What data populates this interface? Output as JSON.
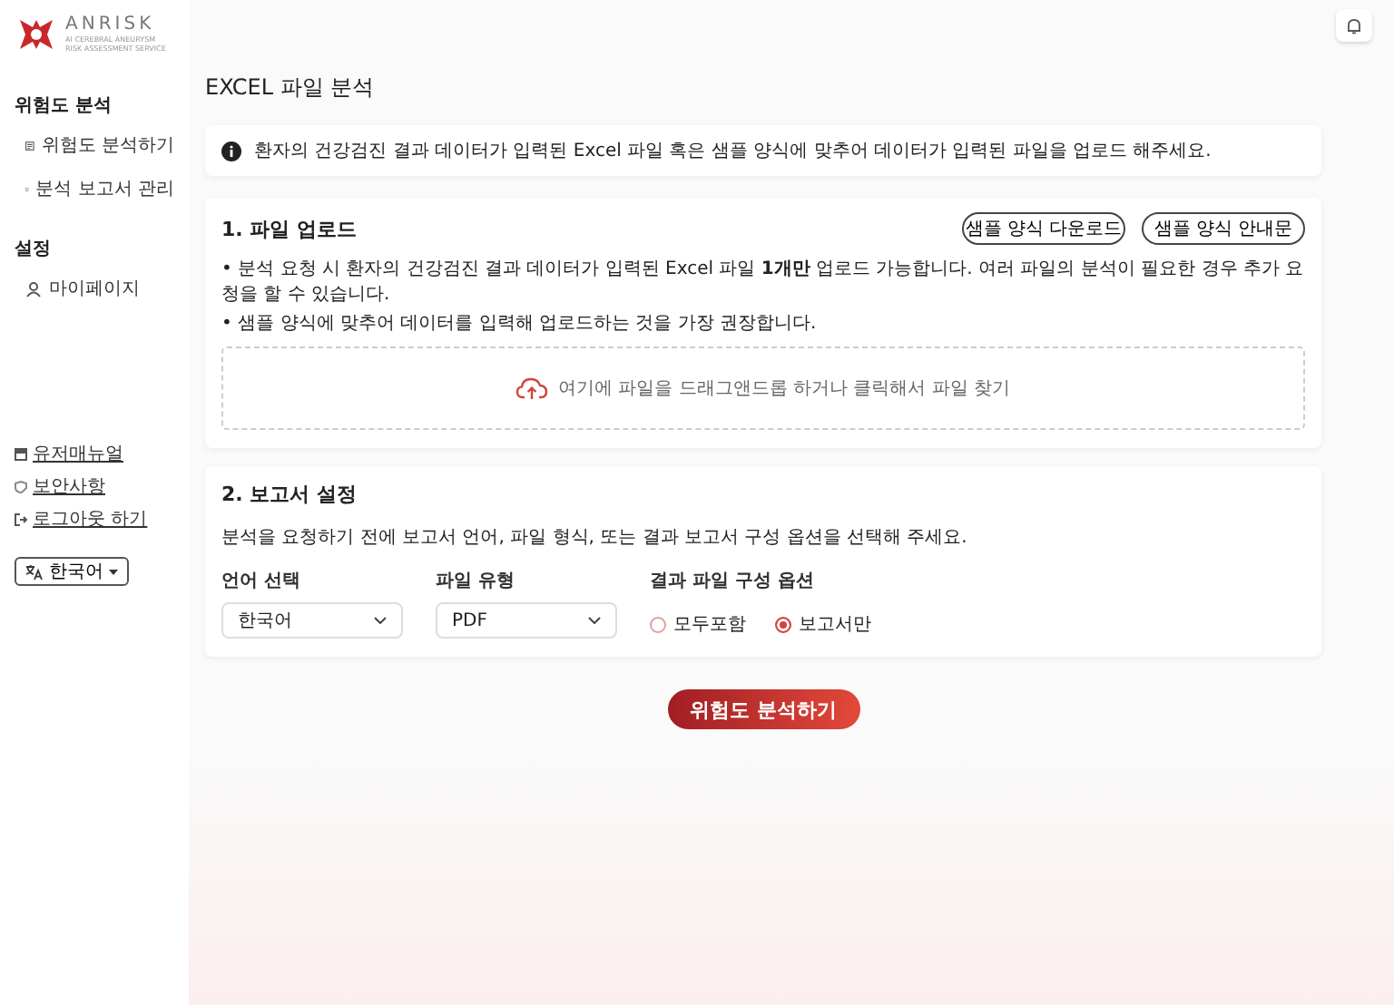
{
  "logo": {
    "name": "ANRISK",
    "tagline": [
      "AI CEREBRAL ANEURYSM",
      "RISK ASSESSMENT SERVICE"
    ]
  },
  "sidebar": {
    "sections": [
      {
        "title": "위험도 분석",
        "items": [
          {
            "label": "위험도 분석하기",
            "kind": "analyze"
          },
          {
            "label": "분석 보고서 관리",
            "kind": "report"
          }
        ]
      },
      {
        "title": "설정",
        "items": [
          {
            "label": "마이페이지",
            "kind": "user"
          }
        ]
      }
    ],
    "links": [
      {
        "label": "유저매뉴얼",
        "kind": "manual"
      },
      {
        "label": "보안사항",
        "kind": "security"
      },
      {
        "label": "로그아웃 하기",
        "kind": "logout"
      }
    ],
    "language": "한국어"
  },
  "page": {
    "title": "EXCEL 파일 분석",
    "notice": "환자의 건강검진 결과 데이터가 입력된 Excel 파일 혹은 샘플 양식에 맞추어 데이터가 입력된 파일을 업로드 해주세요.",
    "upload": {
      "title": "1. 파일 업로드",
      "buttons": [
        "샘플 양식 다운로드",
        "샘플 양식 안내문"
      ],
      "bullets": [
        "• 분석 요청 시 환자의 건강검진 결과 데이터가 입력된 Excel 파일 **1개만** 업로드 가능합니다. 여러 파일의 분석이 필요한 경우 추가 요청을 할 수 있습니다.",
        "• 샘플 양식에 맞추어 데이터를 입력해 업로드하는 것을 가장 권장합니다."
      ],
      "dropzone": "여기에 파일을 드래그앤드롭 하거나 클릭해서 파일 찾기"
    },
    "report": {
      "title": "2. 보고서 설정",
      "description": "분석을 요청하기 전에 보고서 언어, 파일 형식, 또는 결과 보고서 구성 옵션을 선택해 주세요.",
      "language": {
        "label": "언어 선택",
        "value": "한국어"
      },
      "file_type": {
        "label": "파일 유형",
        "value": "PDF"
      },
      "options": {
        "label": "결과 파일 구성 옵션",
        "choices": [
          {
            "label": "모두포함",
            "selected": false
          },
          {
            "label": "보고서만",
            "selected": true
          }
        ]
      }
    },
    "submit": "위험도 분석하기"
  }
}
